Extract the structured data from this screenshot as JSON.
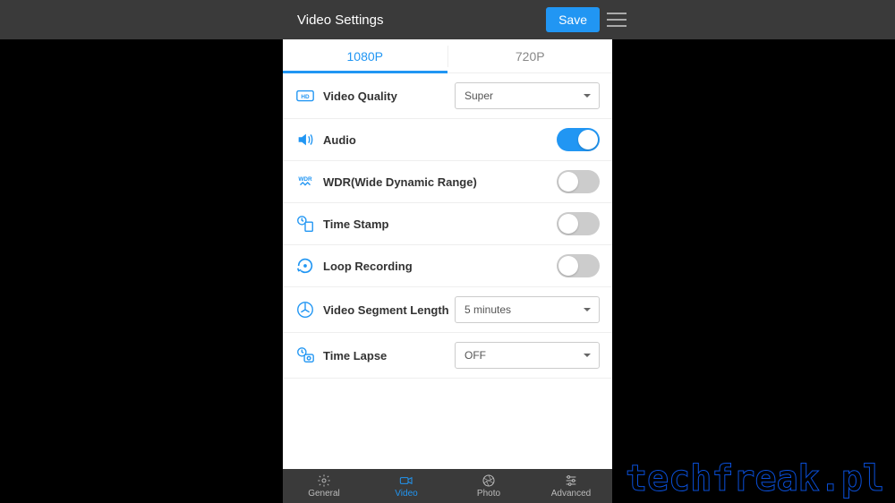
{
  "header": {
    "title": "Video Settings",
    "save_label": "Save"
  },
  "tabs": {
    "t1": "1080P",
    "t2": "720P"
  },
  "rows": {
    "video_quality": {
      "label": "Video Quality",
      "value": "Super"
    },
    "audio": {
      "label": "Audio"
    },
    "wdr": {
      "label": "WDR(Wide Dynamic Range)"
    },
    "timestamp": {
      "label": "Time Stamp"
    },
    "loop": {
      "label": "Loop Recording"
    },
    "segment": {
      "label": "Video Segment Length",
      "value": "5 minutes"
    },
    "timelapse": {
      "label": "Time Lapse",
      "value": "OFF"
    }
  },
  "nav": {
    "general": "General",
    "video": "Video",
    "photo": "Photo",
    "advanced": "Advanced"
  },
  "watermark": "techfreak.pl",
  "colors": {
    "accent": "#2196f3"
  }
}
